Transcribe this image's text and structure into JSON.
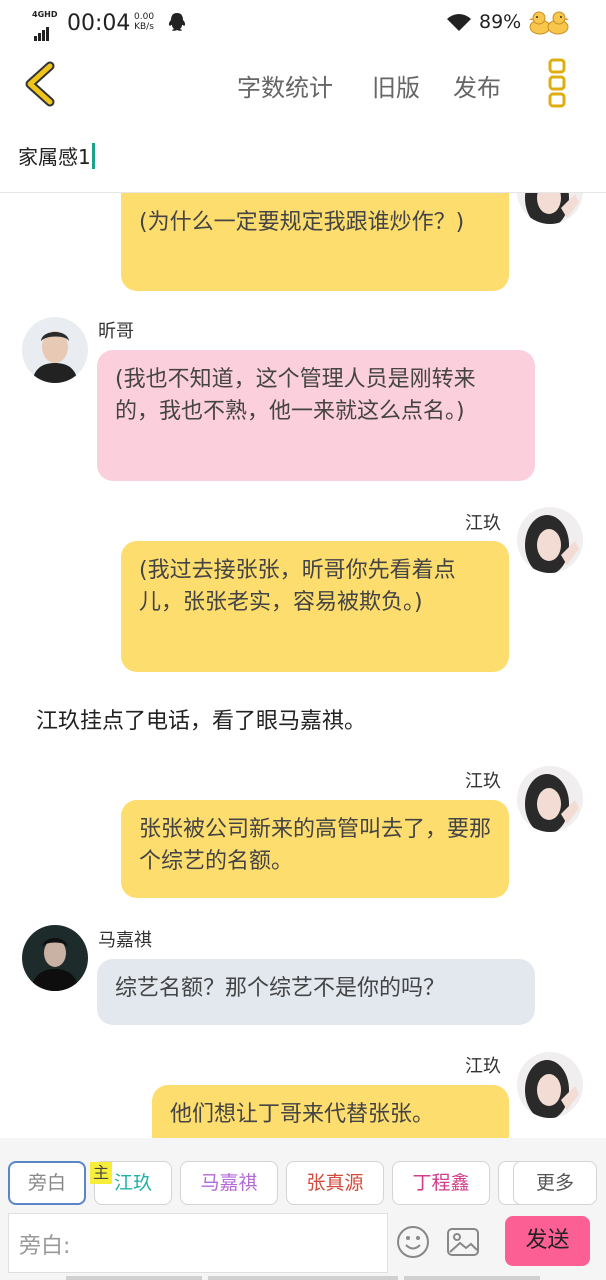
{
  "status_bar": {
    "network": "4GHD",
    "time": "00:04",
    "speed_value": "0.00",
    "speed_unit": "KB/s",
    "battery": "89%",
    "icons": [
      "signal-icon",
      "qq-icon",
      "wifi-icon",
      "duck-sticker-icon"
    ]
  },
  "header": {
    "back_icon": "chevron-left-icon",
    "word_count": "字数统计",
    "old_version": "旧版",
    "publish": "发布",
    "more_icon": "vertical-dots-icon",
    "accent_color": "#f0c419"
  },
  "chapter_title": "家属感1",
  "messages": [
    {
      "type": "bubble",
      "side": "right",
      "speaker": "",
      "color": "#fddd6e",
      "text": "(为什么一定要规定我跟谁炒作？)"
    },
    {
      "type": "bubble",
      "side": "left",
      "speaker": "昕哥",
      "color": "#fbcfdb",
      "text": "(我也不知道，这个管理人员是刚转来的，我也不熟，他一来就这么点名。)"
    },
    {
      "type": "bubble",
      "side": "right",
      "speaker": "江玖",
      "color": "#fddd6e",
      "text": "(我过去接张张，昕哥你先看着点儿，张张老实，容易被欺负。)"
    },
    {
      "type": "narration",
      "text": "江玖挂点了电话，看了眼马嘉祺。"
    },
    {
      "type": "bubble",
      "side": "right",
      "speaker": "江玖",
      "color": "#fddd6e",
      "text": "张张被公司新来的高管叫去了，要那个综艺的名额。"
    },
    {
      "type": "bubble",
      "side": "left",
      "speaker": "马嘉祺",
      "color": "#e3e8ef",
      "text": "综艺名额？那个综艺不是你的吗？"
    },
    {
      "type": "bubble",
      "side": "right",
      "speaker": "江玖",
      "color": "#fddd6e",
      "text": "他们想让丁哥来代替张张。"
    }
  ],
  "roles": [
    {
      "label": "旁白",
      "color": "#888888",
      "selected": true
    },
    {
      "label": "江玖",
      "color": "#20b2aa",
      "selected": false,
      "badge": "主"
    },
    {
      "label": "马嘉祺",
      "color": "#b36ad6",
      "selected": false
    },
    {
      "label": "张真源",
      "color": "#d24b3c",
      "selected": false
    },
    {
      "label": "丁程鑫",
      "color": "#d23c8a",
      "selected": false
    },
    {
      "label": "",
      "color": "#888888",
      "selected": false
    },
    {
      "label": "更多",
      "color": "#555555",
      "selected": false
    }
  ],
  "input": {
    "placeholder": "旁白:",
    "send_label": "发送",
    "emoji_icon": "smile-icon",
    "image_icon": "image-icon"
  }
}
